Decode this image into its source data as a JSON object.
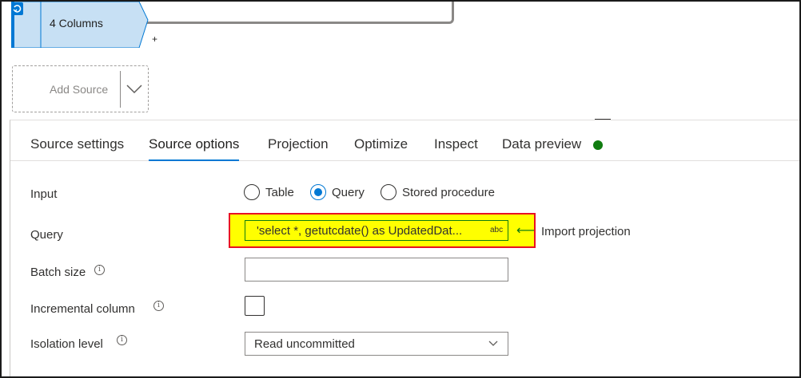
{
  "canvas": {
    "source_node": {
      "label": "4 Columns",
      "plus": "+"
    },
    "add_source": {
      "label": "Add Source"
    }
  },
  "tabs": [
    {
      "label": "Source settings",
      "active": false
    },
    {
      "label": "Source options",
      "active": true
    },
    {
      "label": "Projection",
      "active": false
    },
    {
      "label": "Optimize",
      "active": false
    },
    {
      "label": "Inspect",
      "active": false
    },
    {
      "label": "Data preview",
      "active": false
    }
  ],
  "status_color": "#107c10",
  "accent_color": "#0078d4",
  "form": {
    "input": {
      "label": "Input",
      "options": [
        "Table",
        "Query",
        "Stored procedure"
      ],
      "selected": "Query"
    },
    "query": {
      "label": "Query",
      "value": "'select *, getutcdate() as UpdatedDat...",
      "badge": "abc",
      "arrow": "⟵",
      "import_label": "Import projection"
    },
    "batch_size": {
      "label": "Batch size",
      "value": ""
    },
    "incremental_column": {
      "label": "Incremental column",
      "checked": false
    },
    "isolation_level": {
      "label": "Isolation level",
      "value": "Read uncommitted"
    }
  },
  "icons": {
    "info": "info-icon",
    "database": "database-icon",
    "chevron": "chevron-down-icon"
  }
}
